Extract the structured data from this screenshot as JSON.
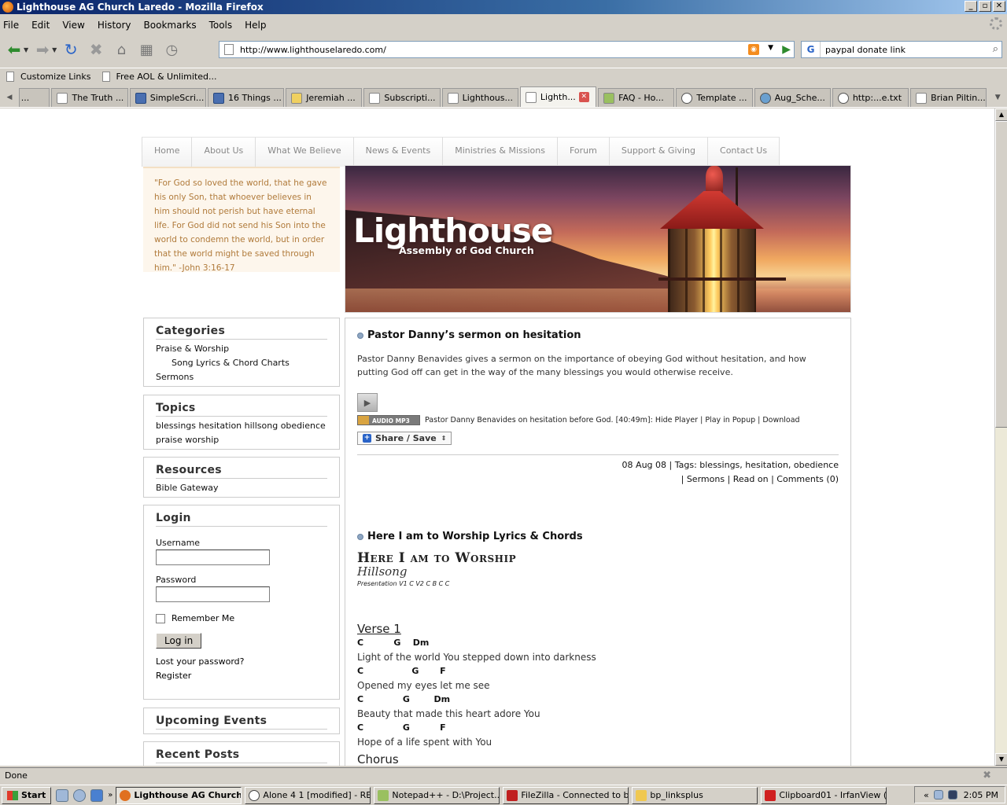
{
  "window": {
    "title": "Lighthouse AG Church Laredo - Mozilla Firefox"
  },
  "menu": [
    "File",
    "Edit",
    "View",
    "History",
    "Bookmarks",
    "Tools",
    "Help"
  ],
  "address": {
    "url": "http://www.lighthouselaredo.com/"
  },
  "search": {
    "value": "paypal donate link",
    "engine_letter": "G"
  },
  "bookmarks": [
    "Customize Links",
    "Free AOL & Unlimited..."
  ],
  "tabs": [
    {
      "label": "The Truth ...",
      "icon": "cbd"
    },
    {
      "label": "SimpleScri...",
      "icon": "fav"
    },
    {
      "label": "16 Things ...",
      "icon": "j"
    },
    {
      "label": "Jeremiah ...",
      "icon": "book"
    },
    {
      "label": "Subscripti...",
      "icon": "page"
    },
    {
      "label": "Lighthous...",
      "icon": "page"
    },
    {
      "label": "Lighth...",
      "icon": "page",
      "active": true
    },
    {
      "label": "FAQ - Ho...",
      "icon": "leaf"
    },
    {
      "label": "Template ...",
      "icon": "wp"
    },
    {
      "label": "Aug_Sche...",
      "icon": "globe"
    },
    {
      "label": "http:...e.txt",
      "icon": "wp"
    },
    {
      "label": "Brian Piltin...",
      "icon": "page"
    }
  ],
  "site": {
    "nav": [
      "Home",
      "About Us",
      "What We Believe",
      "News & Events",
      "Ministries & Missions",
      "Forum",
      "Support & Giving",
      "Contact Us"
    ],
    "quote": "\"For God so loved the world, that he gave his only Son, that whoever believes in him should not perish but have eternal life. For God did not send his Son into the world to condemn the world, but in order that the world might be saved through him.\" -John 3:16-17",
    "banner": {
      "title": "Lighthouse",
      "subtitle": "Assembly of God Church"
    },
    "categories": {
      "heading": "Categories",
      "items": [
        "Praise & Worship",
        "Song Lyrics & Chord Charts",
        "Sermons"
      ]
    },
    "topics": {
      "heading": "Topics",
      "text": "blessings hesitation hillsong obedience praise worship"
    },
    "resources": {
      "heading": "Resources",
      "items": [
        "Bible Gateway"
      ]
    },
    "login": {
      "heading": "Login",
      "username_label": "Username",
      "password_label": "Password",
      "remember": "Remember Me",
      "button": "Log in",
      "lost": "Lost your password?",
      "register": "Register"
    },
    "upcoming": {
      "heading": "Upcoming Events"
    },
    "recent": {
      "heading": "Recent Posts"
    },
    "post1": {
      "title": "Pastor Danny’s sermon on hesitation",
      "text": "Pastor Danny Benavides gives a sermon on the importance of obeying God without hesitation, and how putting God off can get in the way of the many blessings you would otherwise receive.",
      "mp3_badge": "AUDIO MP3",
      "mp3_text": "Pastor Danny Benavides on hesitation before God. [40:49m]: Hide Player | Play in Popup | Download",
      "share": "Share / Save",
      "meta1": "08 Aug 08 | Tags: blessings, hesitation, obedience",
      "meta2": "| Sermons | Read on | Comments (0)"
    },
    "post2": {
      "title": "Here I am to Worship Lyrics & Chords",
      "song_title": "Here I am to Worship",
      "artist": "Hillsong",
      "presentation": "Presentation V1 C V2 C B C C",
      "verse_heading": "Verse 1",
      "lines": [
        {
          "chords": "C          G    Dm",
          "lyric": "Light of the world You stepped down into darkness"
        },
        {
          "chords": "C                G       F",
          "lyric": "Opened my eyes let me see"
        },
        {
          "chords": "C             G        Dm",
          "lyric": "Beauty that made this heart adore You"
        },
        {
          "chords": "C             G          F",
          "lyric": "Hope of a life spent with You"
        }
      ],
      "chorus_heading": "Chorus"
    }
  },
  "status": {
    "text": "Done"
  },
  "taskbar": {
    "start": "Start",
    "tasks": [
      {
        "label": "Lighthouse AG Church...",
        "active": true
      },
      {
        "label": "Alone 4 1 [modified] - RE..."
      },
      {
        "label": "Notepad++ - D:\\Project..."
      },
      {
        "label": "FileZilla - Connected to b..."
      },
      {
        "label": "bp_linksplus"
      },
      {
        "label": "Clipboard01 - IrfanView (..."
      }
    ],
    "clock": "2:05 PM"
  }
}
